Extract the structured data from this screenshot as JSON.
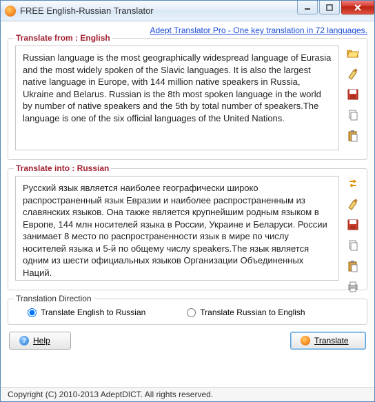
{
  "window": {
    "title": "FREE English-Russian Translator"
  },
  "promo": {
    "text": "Adept Translator Pro - One key translation in 72 languages."
  },
  "source": {
    "label": "Translate from : English",
    "text": "Russian language is the most geographically widespread language of Eurasia and the most widely spoken of the Slavic languages. It is also the largest native language in Europe, with 144 million native speakers in Russia, Ukraine and Belarus. Russian is the 8th most spoken language in the world by number of native speakers and the 5th by total number of speakers.The language is one of the six official languages of the United Nations."
  },
  "target": {
    "label": "Translate into : Russian",
    "text": "Русский язык является наиболее географически широко распространенный язык Евразии и наиболее распространенным из славянских языков. Она также является крупнейшим родным языком в Европе, 144 млн носителей языка в России, Украине и Беларуси. России занимает 8 место по распространенности язык в мире по числу носителей языка и 5-й по общему числу speakers.The язык является одним из шести официальных языков Организации Объединенных Наций."
  },
  "direction": {
    "label": "Translation Direction",
    "opt1": "Translate English to Russian",
    "opt2": "Translate Russian to English",
    "selected": "opt1"
  },
  "buttons": {
    "help": "Help",
    "translate": "Translate"
  },
  "status": "Copyright (C) 2010-2013 AdeptDICT. All rights reserved."
}
